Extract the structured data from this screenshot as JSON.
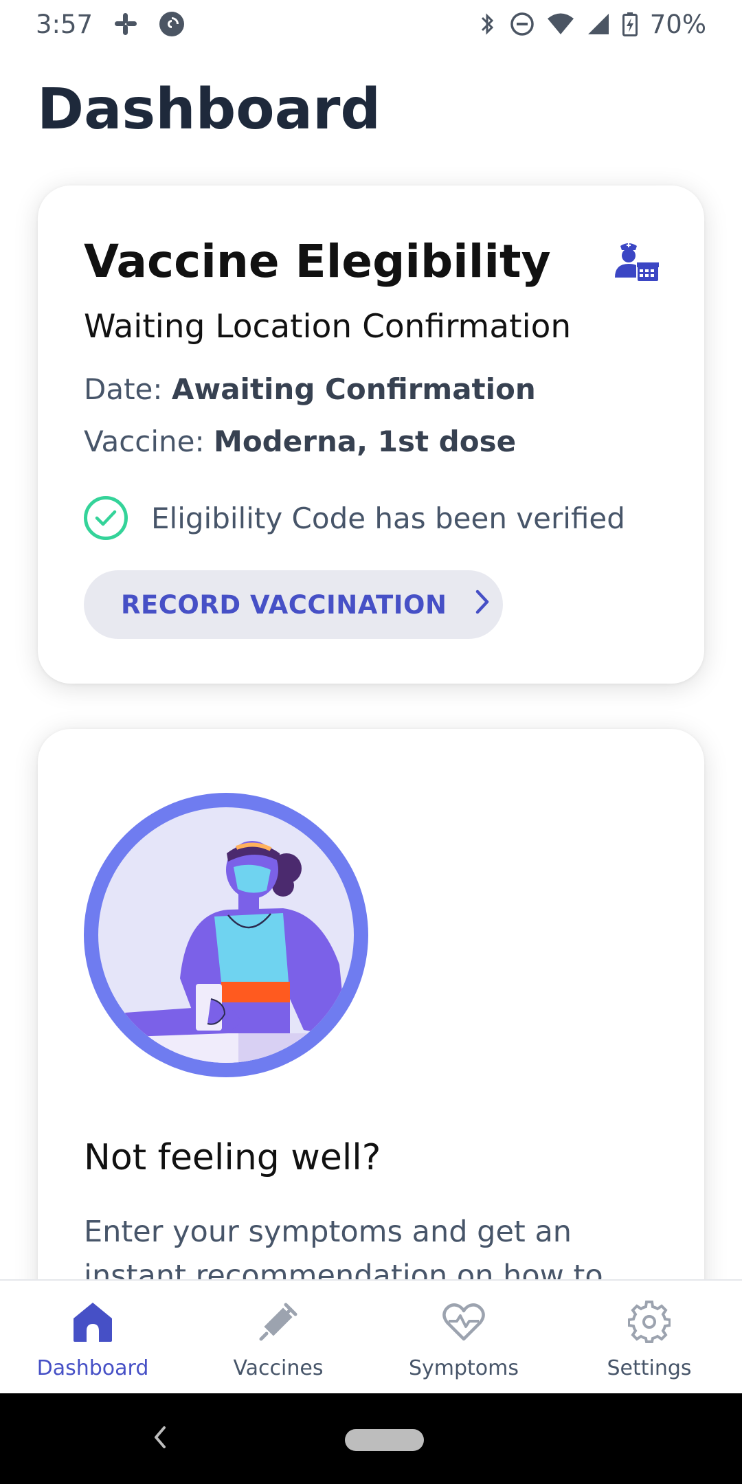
{
  "status_bar": {
    "time": "3:57",
    "battery_percent": "70%",
    "icons": [
      "slack-icon",
      "pocket-casts-icon",
      "bluetooth-icon",
      "do-not-disturb-icon",
      "wifi-icon",
      "signal-icon",
      "battery-charging-icon"
    ]
  },
  "page": {
    "title": "Dashboard"
  },
  "vaccine_card": {
    "title": "Vaccine Elegibility",
    "icon": "doctor-calendar-icon",
    "subtitle": "Waiting Location Confirmation",
    "date_label": "Date:",
    "date_value": "Awaiting Confirmation",
    "vaccine_label": "Vaccine:",
    "vaccine_value": "Moderna, 1st dose",
    "verified_text": "Eligibility Code has been verified",
    "record_button": "RECORD VACCINATION"
  },
  "symptoms_card": {
    "illustration": "masked-person-illustration",
    "title": "Not feeling well?",
    "description": "Enter your symptoms and get an instant recommendation on how to stay safe."
  },
  "bottom_nav": {
    "items": [
      {
        "label": "Dashboard",
        "icon": "home-icon",
        "active": true
      },
      {
        "label": "Vaccines",
        "icon": "syringe-icon",
        "active": false
      },
      {
        "label": "Symptoms",
        "icon": "heart-pulse-icon",
        "active": false
      },
      {
        "label": "Settings",
        "icon": "gear-icon",
        "active": false
      }
    ]
  },
  "colors": {
    "accent": "#4650c6",
    "verified_green": "#34d399",
    "button_bg": "#e8e9f0",
    "title_dark": "#1e293b",
    "illustration_ring": "#6f7cf0"
  }
}
